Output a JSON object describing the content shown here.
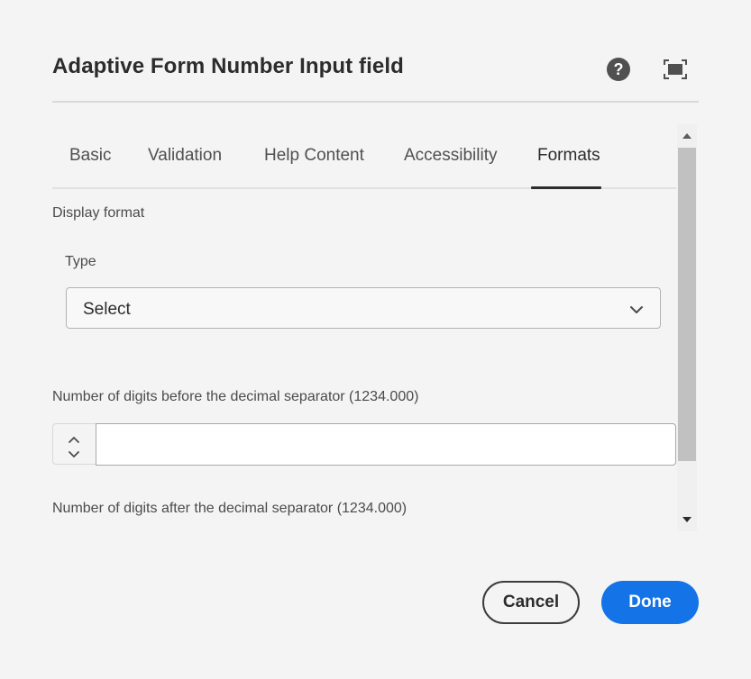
{
  "dialog": {
    "title": "Adaptive Form Number Input field",
    "help_symbol": "?",
    "help_icon": "help-circle-icon",
    "fullscreen_icon": "fullscreen-icon"
  },
  "tabs": [
    {
      "label": "Basic",
      "active": false
    },
    {
      "label": "Validation",
      "active": false
    },
    {
      "label": "Help Content",
      "active": false
    },
    {
      "label": "Accessibility",
      "active": false
    },
    {
      "label": "Formats",
      "active": true
    }
  ],
  "formats": {
    "section_label": "Display format",
    "type_label": "Type",
    "type_select": {
      "value": "Select",
      "icon": "chevron-down-icon"
    },
    "digits_before_label": "Number of digits before the decimal separator (1234.000)",
    "digits_before_value": "",
    "digits_after_label": "Number of digits after the decimal separator (1234.000)"
  },
  "footer": {
    "cancel_label": "Cancel",
    "done_label": "Done"
  },
  "colors": {
    "accent": "#1473e6",
    "background": "#f4f4f4",
    "text": "#2c2c2c"
  }
}
